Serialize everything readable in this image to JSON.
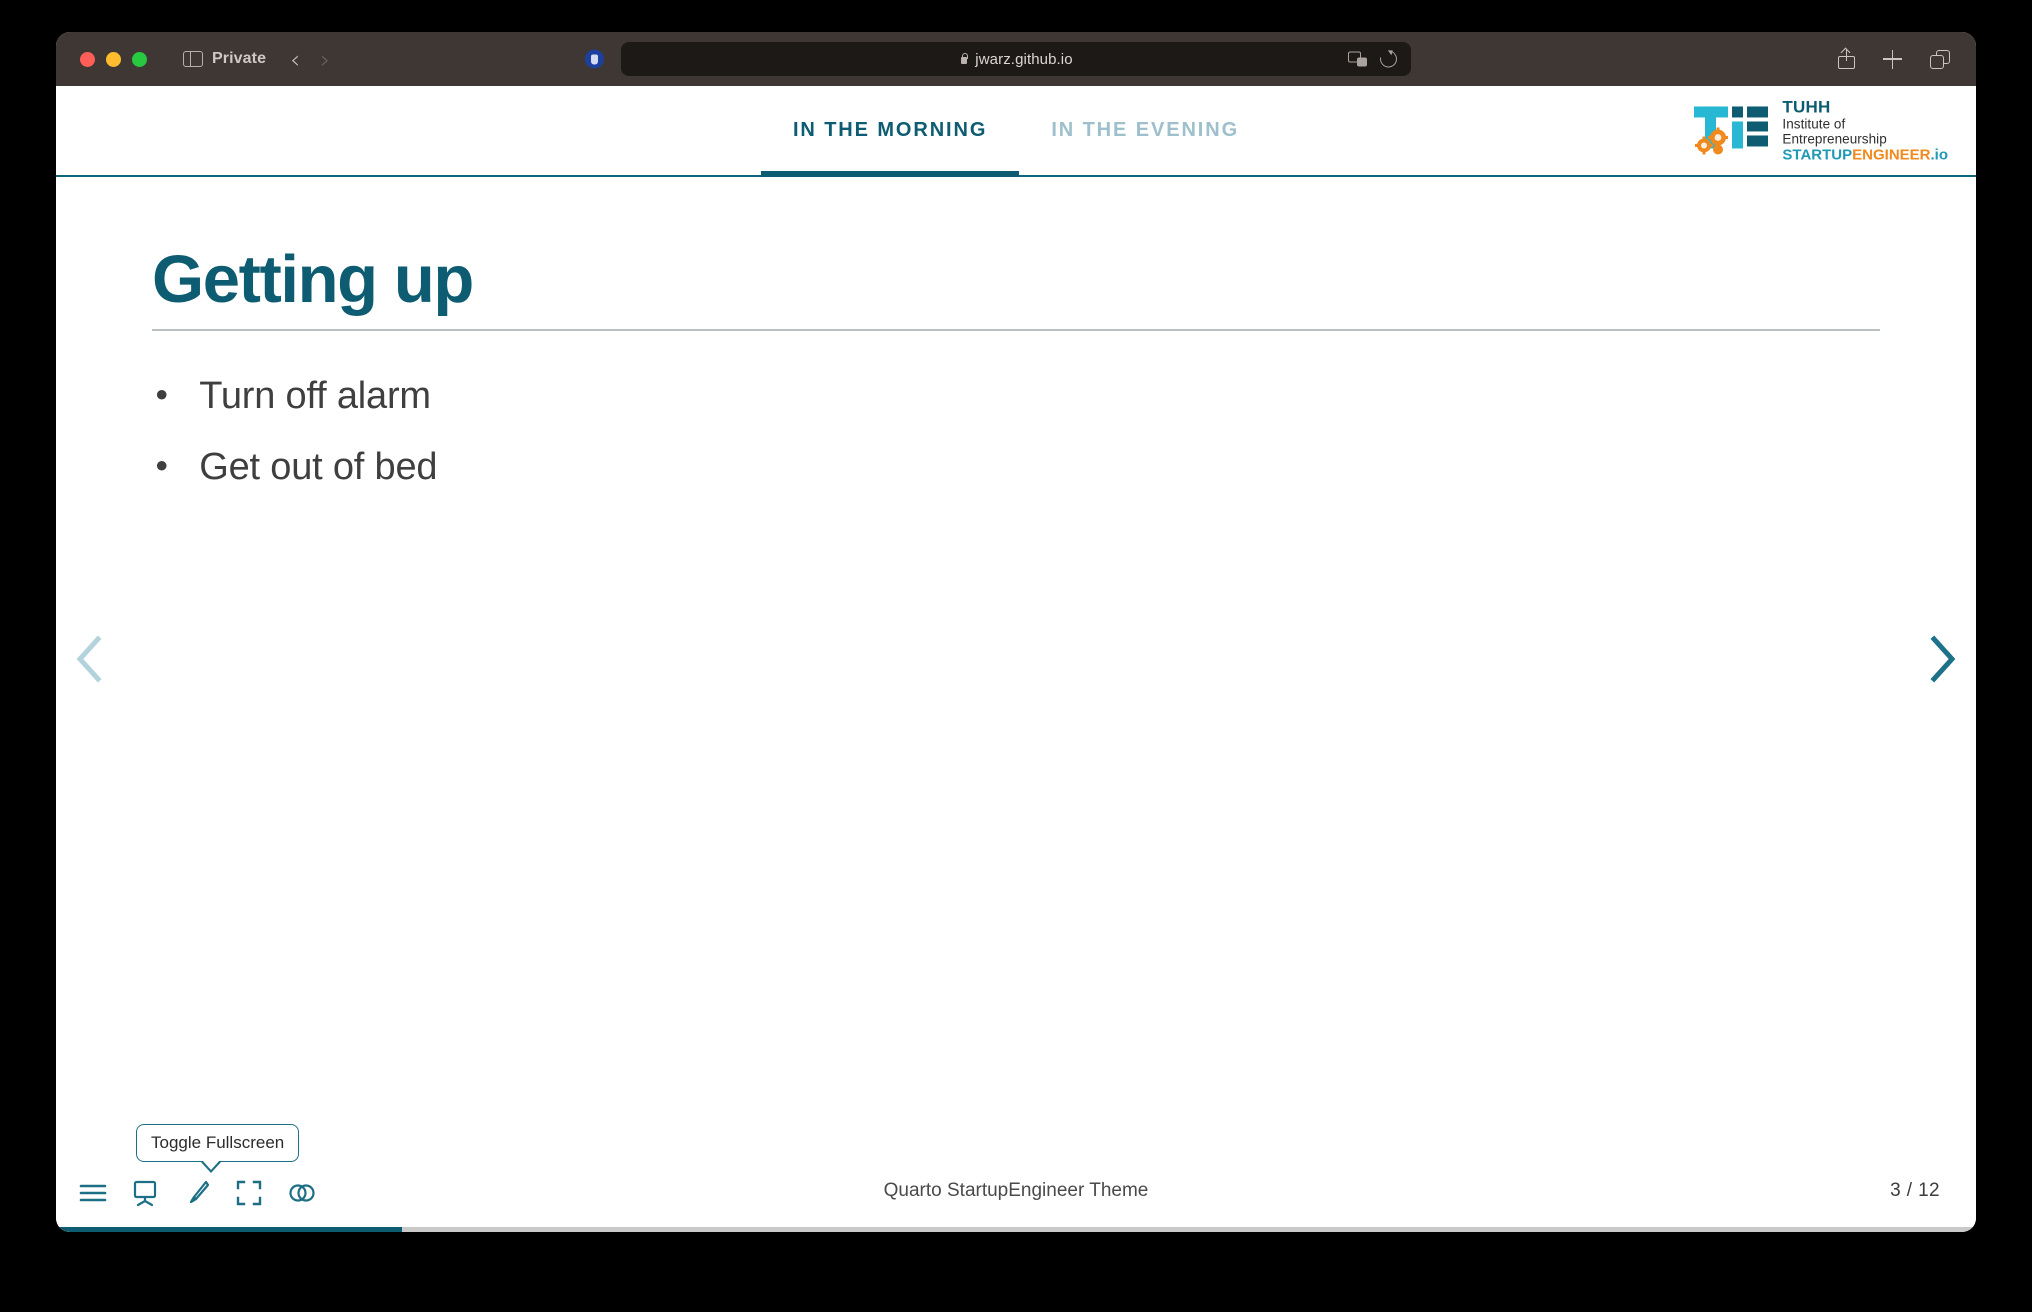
{
  "browser": {
    "mode_label": "Private",
    "sidebar_icon": "sidebar-icon",
    "back_icon": "chevron-left-icon",
    "forward_icon": "chevron-right-icon",
    "privacy_icon": "privacy-shield-icon",
    "lock_icon": "lock-icon",
    "url": "jwarz.github.io",
    "translate_icon": "translate-icon",
    "reload_icon": "reload-icon",
    "share_icon": "share-icon",
    "new_tab_icon": "plus-icon",
    "tab_overview_icon": "tab-overview-icon",
    "traffic_lights": {
      "close": "#ff5f57",
      "minimize": "#febc2e",
      "zoom": "#28c840"
    }
  },
  "slide_header": {
    "tabs": [
      {
        "label": "IN THE MORNING",
        "active": true
      },
      {
        "label": "IN THE EVENING",
        "active": false
      }
    ],
    "logo": {
      "mark": "tie-monogram-icon",
      "title": "TUHH",
      "line1": "Institute of",
      "line2": "Entrepreneurship",
      "startup": "STARTUP",
      "engineer": "ENGINEER",
      "io": ".io"
    }
  },
  "slide": {
    "title": "Getting up",
    "bullet_marker": "•",
    "bullets": [
      "Turn off alarm",
      "Get out of bed"
    ],
    "prev_icon": "chevron-left-icon",
    "next_icon": "chevron-right-icon"
  },
  "controls": {
    "menu_icon": "hamburger-menu-icon",
    "presentation_icon": "easel-icon",
    "draw_icon": "paintbrush-icon",
    "fullscreen_icon": "fullscreen-icon",
    "overview_icon": "overlapping-circles-icon",
    "tooltip": "Toggle Fullscreen"
  },
  "footer": {
    "text": "Quarto StartupEngineer Theme",
    "counter": "3 / 12",
    "progress_percent": 18
  },
  "colors": {
    "brand_teal": "#0d5c72",
    "brand_cyan": "#1f9ab5",
    "brand_orange": "#f08a1e",
    "tab_inactive": "#9dc0cc",
    "body_text": "#3f3f3f"
  }
}
